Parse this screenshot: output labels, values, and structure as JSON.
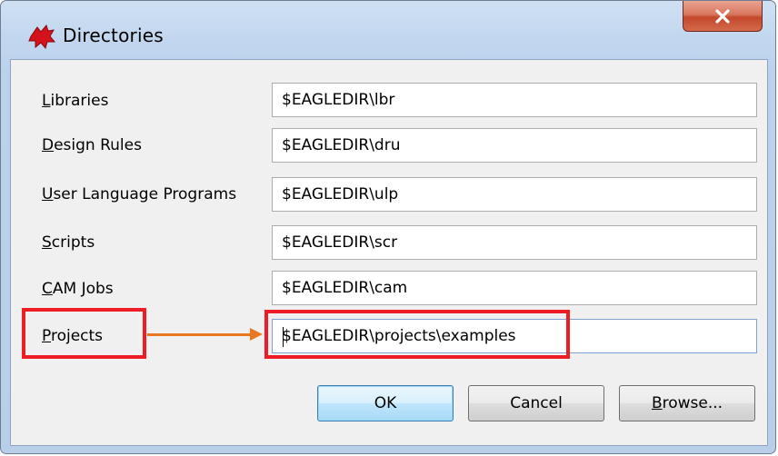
{
  "window": {
    "title": "Directories"
  },
  "rows": [
    {
      "accel": "L",
      "rest": "ibraries",
      "value": "$EAGLEDIR\\lbr"
    },
    {
      "accel": "D",
      "rest": "esign Rules",
      "value": "$EAGLEDIR\\dru"
    },
    {
      "accel": "U",
      "rest": "ser Language Programs",
      "value": "$EAGLEDIR\\ulp"
    },
    {
      "accel": "S",
      "rest": "cripts",
      "value": "$EAGLEDIR\\scr"
    },
    {
      "accel": "C",
      "rest": "AM Jobs",
      "value": "$EAGLEDIR\\cam"
    },
    {
      "accel": "P",
      "rest": "rojects",
      "value": "$EAGLEDIR\\projects\\examples"
    }
  ],
  "buttons": {
    "ok": "OK",
    "cancel": "Cancel",
    "browse_accel": "B",
    "browse_rest": "rowse..."
  },
  "colors": {
    "highlight": "#ee1c24",
    "arrow": "#e87722",
    "close_button": "#c3482c"
  }
}
